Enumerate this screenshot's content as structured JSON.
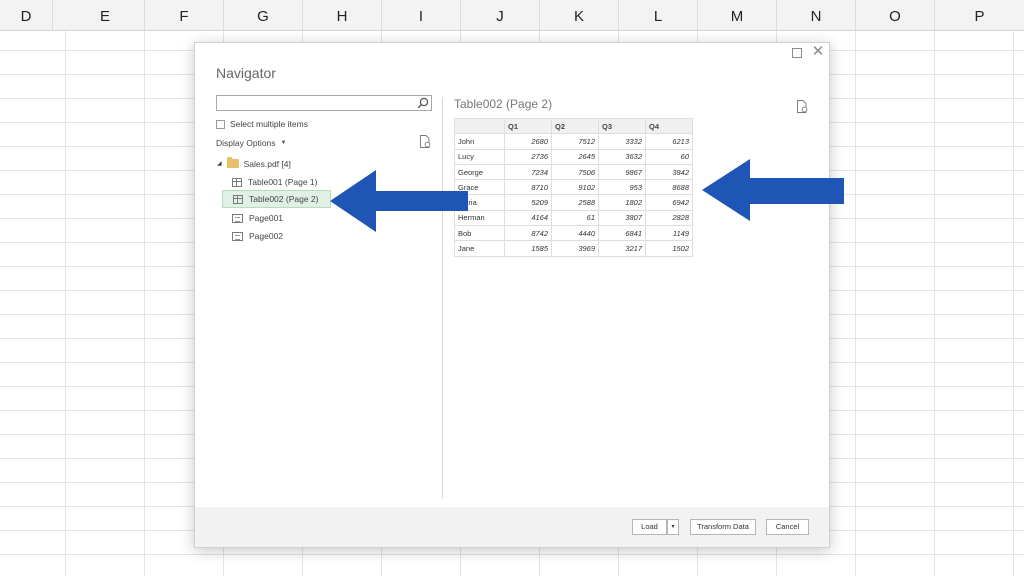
{
  "spreadsheet": {
    "columns": [
      "D",
      "E",
      "F",
      "G",
      "H",
      "I",
      "J",
      "K",
      "L",
      "M",
      "N",
      "O",
      "P"
    ]
  },
  "navigator": {
    "title": "Navigator",
    "search": {
      "value": "",
      "placeholder": ""
    },
    "select_multiple_label": "Select multiple items",
    "display_options_label": "Display Options",
    "tree": {
      "root_label": "Sales.pdf [4]",
      "items": [
        {
          "label": "Table001 (Page 1)",
          "icon": "table-icon",
          "selected": false
        },
        {
          "label": "Table002 (Page 2)",
          "icon": "table-icon",
          "selected": true
        },
        {
          "label": "Page001",
          "icon": "page-icon",
          "selected": false
        },
        {
          "label": "Page002",
          "icon": "page-icon",
          "selected": false
        }
      ]
    },
    "preview": {
      "title": "Table002 (Page 2)",
      "headers": [
        "",
        "Q1",
        "Q2",
        "Q3",
        "Q4"
      ],
      "rows": [
        {
          "name": "John",
          "values": [
            "2680",
            "7512",
            "3332",
            "6213"
          ]
        },
        {
          "name": "Lucy",
          "values": [
            "2736",
            "2645",
            "3632",
            "60"
          ]
        },
        {
          "name": "George",
          "values": [
            "7234",
            "7506",
            "9867",
            "3842"
          ]
        },
        {
          "name": "Grace",
          "values": [
            "8710",
            "9102",
            "953",
            "8688"
          ]
        },
        {
          "name": "Maria",
          "values": [
            "5209",
            "2588",
            "1802",
            "6942"
          ]
        },
        {
          "name": "Herman",
          "values": [
            "4164",
            "61",
            "3807",
            "2828"
          ]
        },
        {
          "name": "Bob",
          "values": [
            "8742",
            "4440",
            "6841",
            "1149"
          ]
        },
        {
          "name": "Jane",
          "values": [
            "1585",
            "3969",
            "3217",
            "1502"
          ]
        }
      ]
    },
    "footer": {
      "load_label": "Load",
      "load_dropdown": "▾",
      "transform_label": "Transform Data",
      "cancel_label": "Cancel"
    },
    "window_controls": {
      "maximize": "",
      "close": "✕"
    }
  },
  "annotations": {
    "arrow_color": "#1f56b5"
  }
}
